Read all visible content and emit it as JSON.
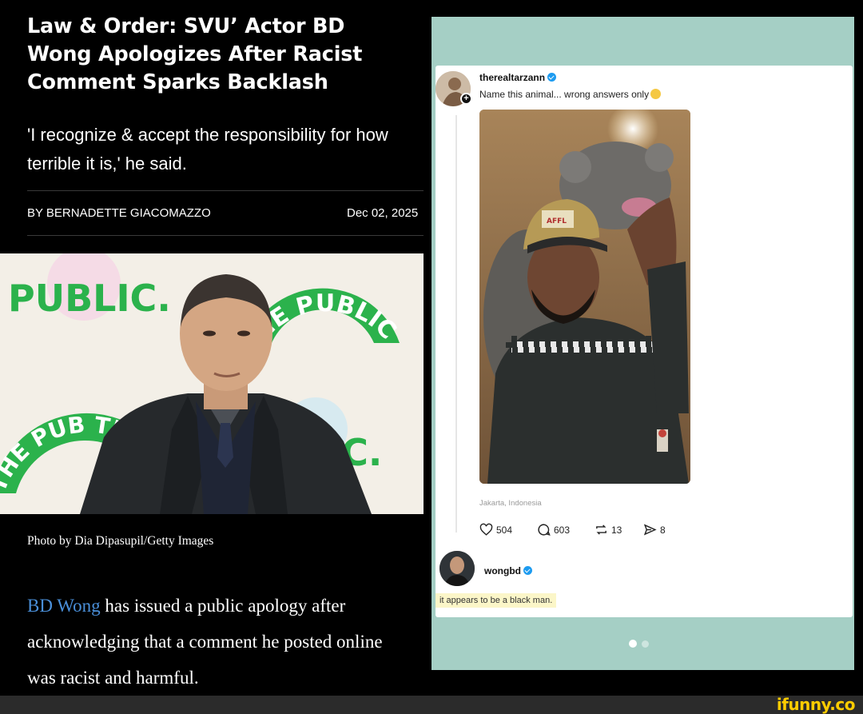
{
  "article": {
    "headline": "Law & Order: SVU’ Actor BD Wong Apologizes After Racist Comment Sparks Backlash",
    "subhead": "'I recognize & accept the responsibility for how terrible it is,' he said.",
    "author": "BY BERNADETTE GIACOMAZZO",
    "date": "Dec 02, 2025",
    "photo": {
      "backdrop_text_public": "PUBLIC.",
      "backdrop_arc_text": "THE PUBLIC THEATER",
      "backdrop_arc_text_2": "THE PUB THEATER",
      "backdrop_text_ic": "IC."
    },
    "caption": "Photo by Dia Dipasupil/Getty Images",
    "body_link": "BD Wong",
    "body_rest": " has issued a public apology after acknowledging that a comment he posted online was racist and harmful."
  },
  "post": {
    "username": "therealtarzann",
    "text": "Name this animal... wrong answers only",
    "emoji": "rolling-on-floor-laughing-emoji",
    "media_badge": "AFFL",
    "location": "Jakarta, Indonesia",
    "likes": "504",
    "comments": "603",
    "reposts": "13",
    "shares": "8",
    "reply": {
      "username": "wongbd",
      "text": "it appears to be a black man."
    }
  },
  "carousel": {
    "count": 2,
    "active": 0
  },
  "watermark": "ifunny.co",
  "colors": {
    "link": "#4a8fd9",
    "post_bg": "#a5cfc5",
    "verified": "#1d9bf0",
    "highlight": "#fbf6c8",
    "watermark": "#ffcc00",
    "backdrop_green": "#2bb24c"
  }
}
